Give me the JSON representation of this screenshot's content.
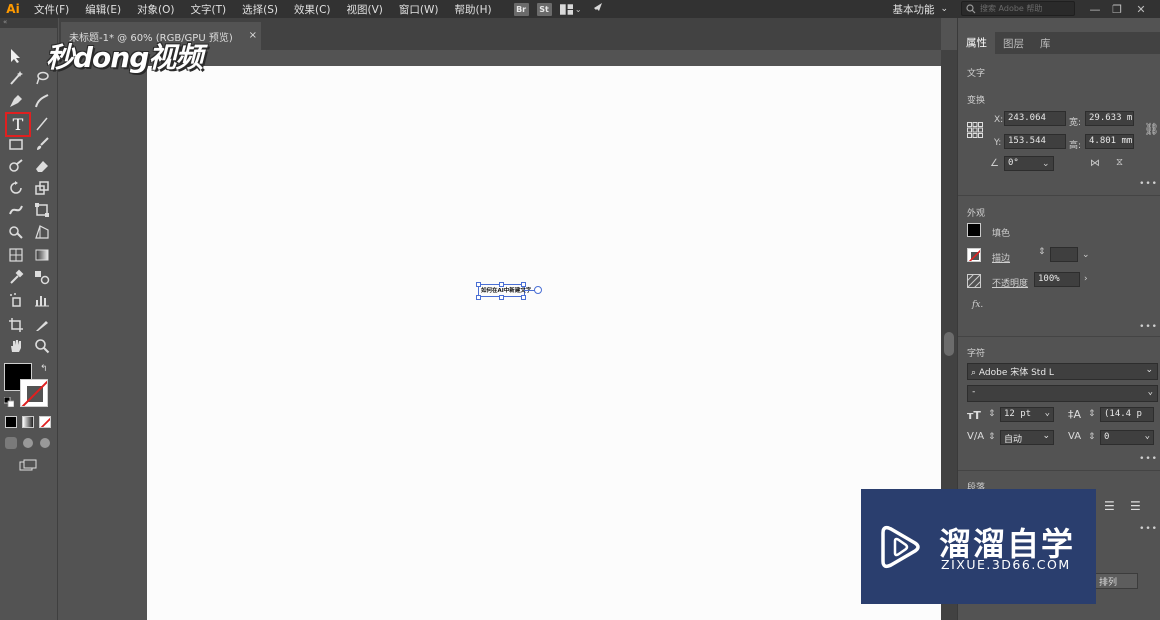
{
  "menubar": {
    "app_logo": "Ai",
    "items": [
      "文件(F)",
      "编辑(E)",
      "对象(O)",
      "文字(T)",
      "选择(S)",
      "效果(C)",
      "视图(V)",
      "窗口(W)",
      "帮助(H)"
    ],
    "bridge_badge": "Br",
    "stock_badge": "St",
    "workspace": "基本功能",
    "search_placeholder": "搜索 Adobe 帮助"
  },
  "document": {
    "tab_title": "未标题-1* @ 60% (RGB/GPU 预览)",
    "tab_close": "×",
    "text_frame_content": "如何在AI中新建文字"
  },
  "watermark_top": {
    "text": "秒dong视频"
  },
  "right_panel": {
    "tabs": [
      "属性",
      "图层",
      "库"
    ],
    "section_text": "文字",
    "section_transform": "变换",
    "x_label": "X:",
    "x_value": "243.064",
    "w_label": "宽:",
    "w_value": "29.633 m",
    "y_label": "Y:",
    "y_value": "153.544",
    "h_label": "高:",
    "h_value": "4.801 mm",
    "angle_value": "0°",
    "section_appearance": "外观",
    "fill_label": "填色",
    "stroke_label": "描边",
    "opacity_label": "不透明度",
    "opacity_value": "100%",
    "fx_label": "fx.",
    "section_character": "字符",
    "font_family": "Adobe 宋体 Std L",
    "font_style": "-",
    "font_size": "12 pt",
    "leading": "(14.4 p",
    "kerning": "自动",
    "tracking": "0",
    "section_paragraph": "段落",
    "align_button": "排列",
    "more": "•••"
  },
  "watermark_bottom": {
    "title": "溜溜自学",
    "url": "ZIXUE.3D66.COM"
  },
  "colors": {
    "app_bg": "#535353",
    "menubar_bg": "#323232",
    "artboard": "#fcfcfc",
    "selection": "#4a6fd4",
    "active_tool_border": "#e02020",
    "watermark_box": "#2a3e6e"
  }
}
